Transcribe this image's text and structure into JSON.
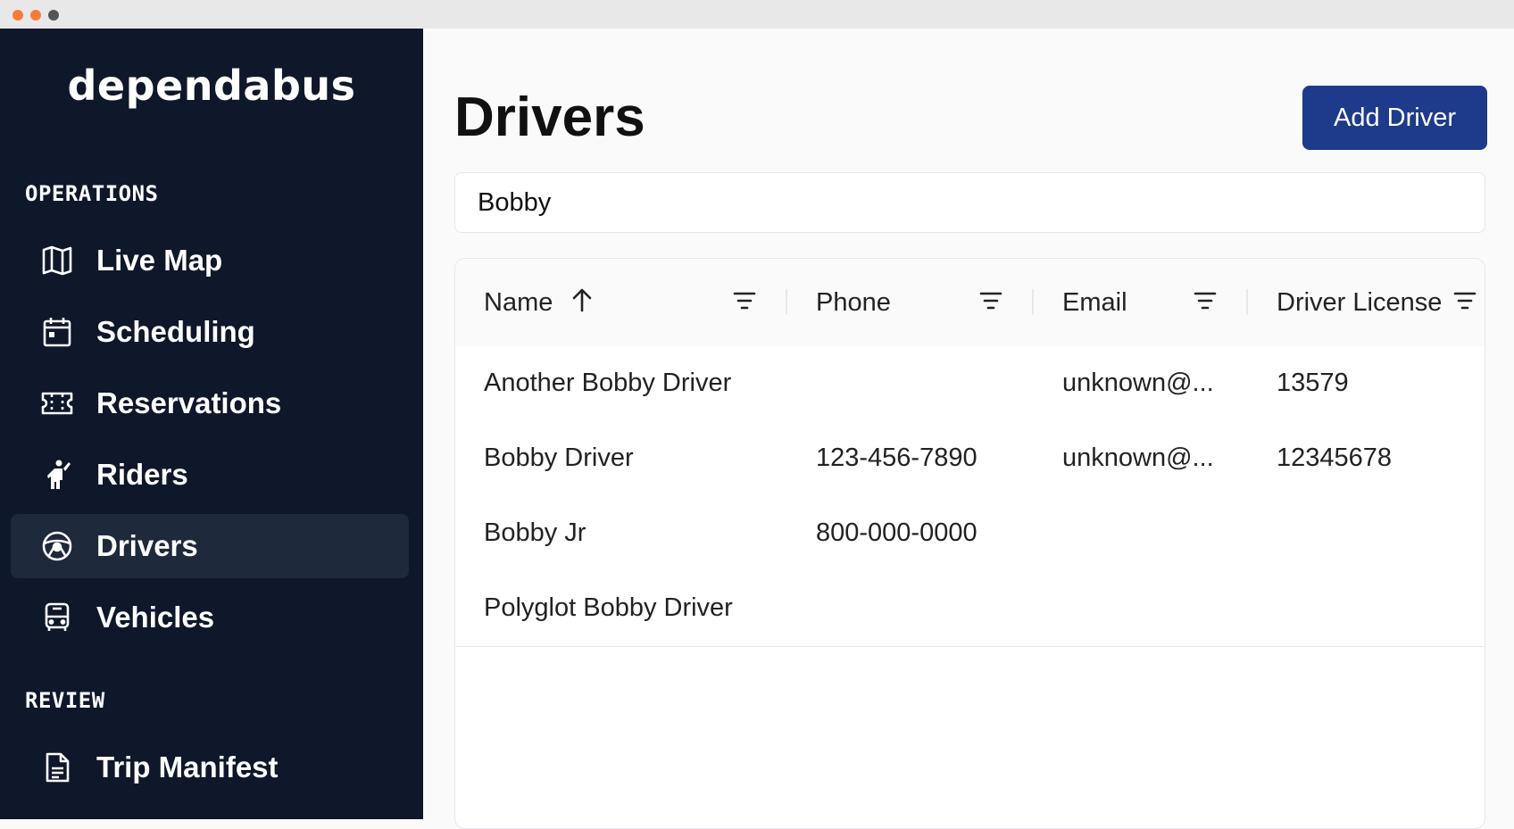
{
  "app": {
    "logo": "dependabus"
  },
  "window_dots": [
    "#f87b3a",
    "#f87b3a",
    "#555555"
  ],
  "sidebar": {
    "sections": [
      {
        "label": "OPERATIONS"
      },
      {
        "label": "REVIEW"
      }
    ],
    "items": [
      {
        "label": "Live Map",
        "icon": "map-icon"
      },
      {
        "label": "Scheduling",
        "icon": "calendar-icon"
      },
      {
        "label": "Reservations",
        "icon": "ticket-icon"
      },
      {
        "label": "Riders",
        "icon": "rider-icon"
      },
      {
        "label": "Drivers",
        "icon": "steering-wheel-icon",
        "active": true
      },
      {
        "label": "Vehicles",
        "icon": "bus-icon"
      },
      {
        "label": "Trip Manifest",
        "icon": "document-icon"
      }
    ]
  },
  "main": {
    "title": "Drivers",
    "add_button": "Add Driver",
    "search_value": "Bobby"
  },
  "table": {
    "columns": [
      {
        "label": "Name",
        "sorted": "ascending"
      },
      {
        "label": "Phone"
      },
      {
        "label": "Email"
      },
      {
        "label": "Driver License"
      }
    ],
    "rows": [
      {
        "name": "Another Bobby Driver",
        "phone": "",
        "email": "unknown@...",
        "license": "13579"
      },
      {
        "name": "Bobby Driver",
        "phone": "123-456-7890",
        "email": "unknown@...",
        "license": "12345678"
      },
      {
        "name": "Bobby Jr",
        "phone": "800-000-0000",
        "email": "",
        "license": ""
      },
      {
        "name": "Polyglot Bobby Driver",
        "phone": "",
        "email": "",
        "license": ""
      }
    ]
  },
  "colors": {
    "sidebar_bg": "#0f172a",
    "active_item_bg": "#1e293b",
    "primary_button": "#1e3a8a"
  }
}
